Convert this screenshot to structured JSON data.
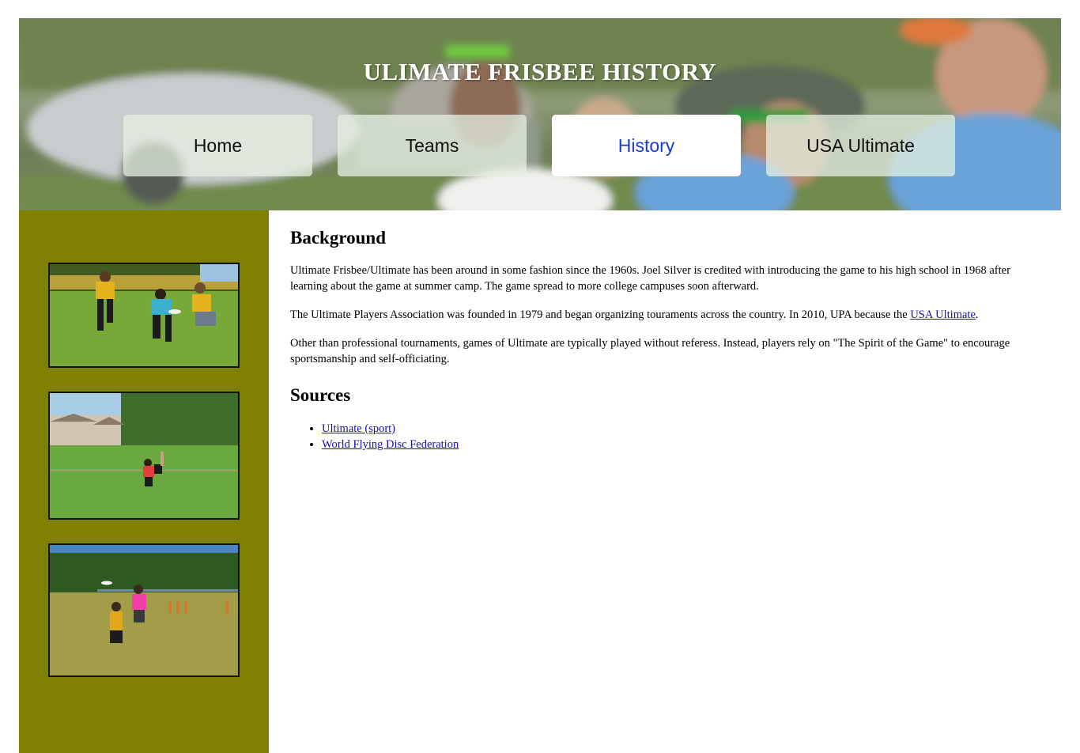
{
  "header": {
    "title": "ULIMATE FRISBEE HISTORY"
  },
  "nav": {
    "items": [
      {
        "label": "Home",
        "active": false
      },
      {
        "label": "Teams",
        "active": false
      },
      {
        "label": "History",
        "active": true
      },
      {
        "label": "USA Ultimate",
        "active": false
      }
    ]
  },
  "sidebar": {
    "background": "#808000",
    "photos": [
      {
        "name": "photo-players-defending"
      },
      {
        "name": "photo-player-catching-field"
      },
      {
        "name": "photo-players-jumping"
      }
    ]
  },
  "main": {
    "background_heading": "Background",
    "p1": "Ultimate Frisbee/Ultimate has been around in some fashion since the 1960s. Joel Silver is credited with introducing the game to his high school in 1968 after learning about the game at summer camp. The game spread to more college campuses soon afterward.",
    "p2_before": "The Ultimate Players Association was founded in 1979 and began organizing touraments across the country. In 2010, UPA because the ",
    "p2_link": "USA Ultimate",
    "p2_after": ".",
    "p3": "Other than professional tournaments, games of Ultimate are typically played without referess. Instead, players rely on \"The Spirit of the Game\" to encourage sportsmanship and self-officiating.",
    "sources_heading": "Sources",
    "sources": [
      {
        "label": "Ultimate (sport)"
      },
      {
        "label": "World Flying Disc Federation"
      }
    ]
  },
  "colors": {
    "link": "#1a0dab",
    "active_nav_text": "#1a3bd0"
  }
}
